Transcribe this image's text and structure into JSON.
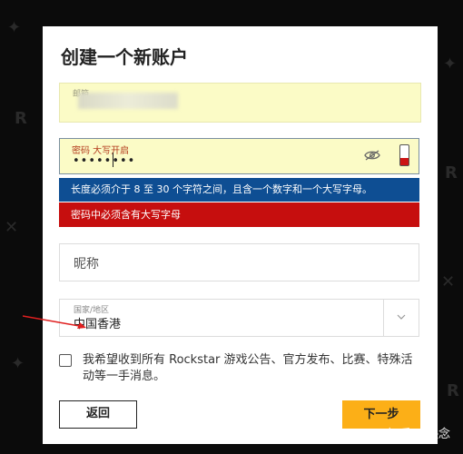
{
  "dialog": {
    "title": "创建一个新账户",
    "email": {
      "label": "邮箱"
    },
    "password": {
      "label": "密码 大写开启",
      "value": "••••••••",
      "strength_indicator_color": "#cc1414",
      "strength_level": 0.35
    },
    "info_message": "长度必须介于 8 至 30 个字符之间，且含一个数字和一个大写字母。",
    "error_message": "密码中必须含有大写字母",
    "nickname": {
      "placeholder": "昵称"
    },
    "country": {
      "label": "国家/地区",
      "value": "中国香港"
    },
    "consent_text": "我希望收到所有 Rockstar 游戏公告、官方发布、比赛、特殊活动等一手消息。",
    "back_label": "返回",
    "next_label": "下一步"
  },
  "watermark": "知乎 @熙念",
  "colors": {
    "info_bar": "#0e4e93",
    "error_bar": "#c60e0e",
    "next_button": "#fcaf17",
    "field_autofill": "#fbfbc6"
  }
}
